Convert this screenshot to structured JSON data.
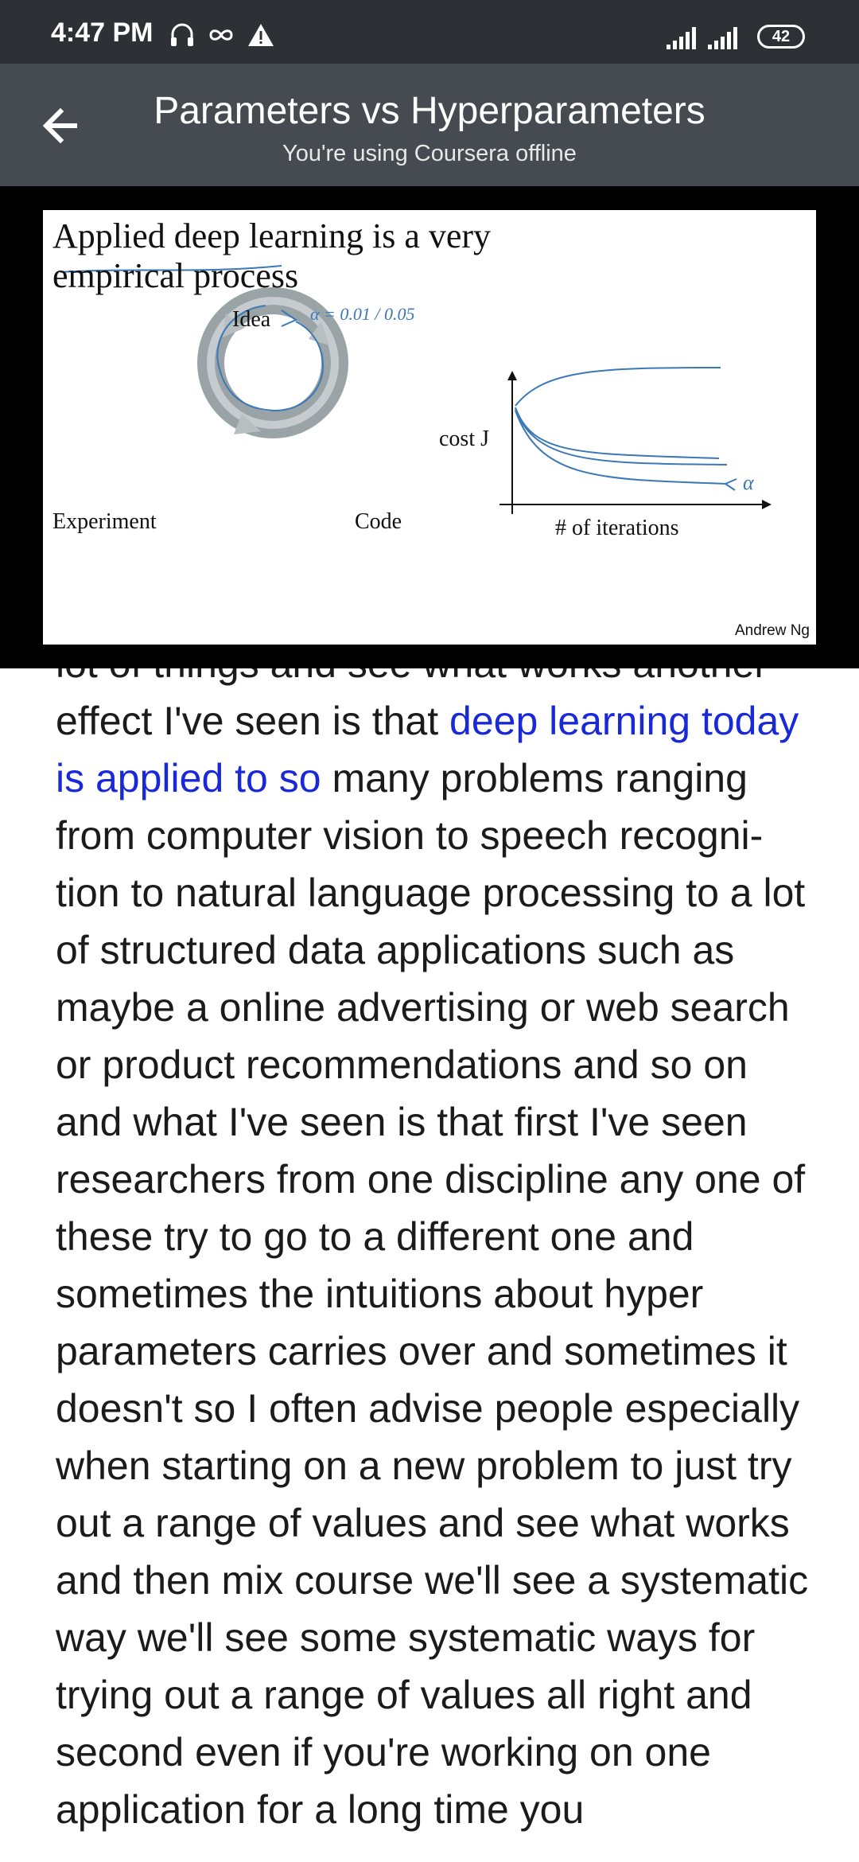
{
  "status_bar": {
    "time": "4:47 PM",
    "battery": "42",
    "icons": [
      "headset-icon",
      "infinity-icon",
      "warning-icon",
      "signal-icon",
      "signal-icon"
    ]
  },
  "app_bar": {
    "title": "Parameters vs Hyperparameters",
    "subtitle": "You're using Coursera offline",
    "back_icon": "arrow-back-icon"
  },
  "slide": {
    "title_line1": "Applied deep learning is a very",
    "title_line2": "empirical process",
    "cycle_labels": {
      "idea": "Idea",
      "code": "Code",
      "experiment": "Experiment"
    },
    "handwritten_alpha": "α = 0.01 / 0.05",
    "handwritten_arrow_alpha": "α",
    "y_axis_label": "cost J",
    "x_axis_label": "# of iterations",
    "credit": "Andrew Ng"
  },
  "transcript": {
    "partial_top_line": "lot of things and see what works another",
    "before_highlight": "effect I've seen is that ",
    "highlight": "deep learning today is applied to so",
    "after_highlight": " many problems ranging from computer vision to speech recogni-tion to natural language processing to a lot of structured data applications such as maybe a online advertising or web search or product recommendations and so on and what I've seen is that first I've seen researchers from one discipline any one of these try to go to a different one and sometimes the intuitions about hyper parameters carries over and sometimes it doesn't so I often advise people especially when starting on a new problem to just try out a range of values and see what works and then mix course we'll see a systematic way we'll see some systematic ways for trying out a range of values all right and second even if you're working on one application for a long time you"
  },
  "colors": {
    "status_bar_bg": "#2d3035",
    "app_bar_bg": "#464b52",
    "highlight": "#1a29d8",
    "pen_blue": "#3a78b8"
  }
}
